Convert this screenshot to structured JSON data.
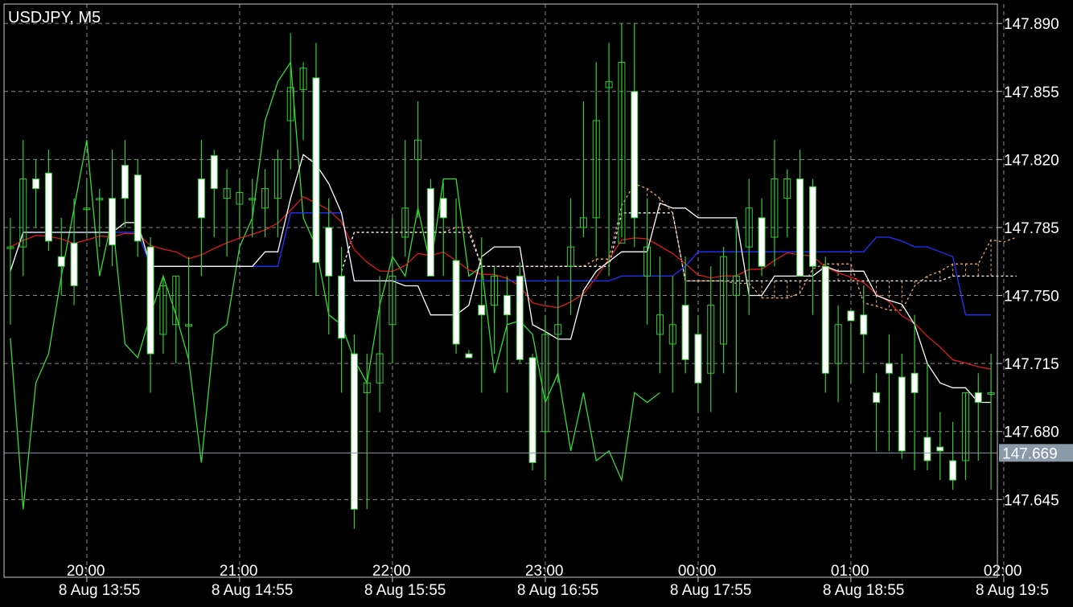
{
  "header": {
    "symbol_timeframe": "USDJPY, M5"
  },
  "colors": {
    "background": "#000000",
    "frame": "#c8c8c8",
    "grid": "#8a8a8a",
    "candle_body": "#ffffff",
    "candle_wick": "#33cc33",
    "red_line": "#e01b1b",
    "blue_line": "#2233ff",
    "white_line": "#ffffff",
    "green_line": "#33dd33",
    "cloud": "#f0a56a",
    "current_price_line": "#8a9aa8",
    "price_tag_bg": "#8a9aa8"
  },
  "chart_data": {
    "type": "candlestick",
    "symbol": "USDJPY",
    "timeframe": "M5",
    "ylim": [
      147.605,
      147.9
    ],
    "y_ticks": [
      "147.890",
      "147.855",
      "147.820",
      "147.785",
      "147.750",
      "147.715",
      "147.680",
      "147.645"
    ],
    "current_price": {
      "label": "147.669",
      "value": 147.669
    },
    "time_labels_upper": [
      {
        "label": "20:00",
        "index": 6
      },
      {
        "label": "21:00",
        "index": 18
      },
      {
        "label": "22:00",
        "index": 30
      },
      {
        "label": "23:00",
        "index": 42
      },
      {
        "label": "00:00",
        "index": 54
      },
      {
        "label": "01:00",
        "index": 66
      },
      {
        "label": "02:00",
        "index": 78
      }
    ],
    "time_labels_lower": [
      {
        "label": "8 Aug 13:55",
        "index": 6
      },
      {
        "label": "8 Aug 14:55",
        "index": 18
      },
      {
        "label": "8 Aug 15:55",
        "index": 30
      },
      {
        "label": "8 Aug 16:55",
        "index": 42
      },
      {
        "label": "8 Aug 17:55",
        "index": 54
      },
      {
        "label": "8 Aug 18:55",
        "index": 66
      },
      {
        "label": "8 Aug 19:5",
        "index": 78
      }
    ],
    "candles": [
      [
        147.775,
        147.79,
        147.735,
        147.775
      ],
      [
        147.775,
        147.83,
        147.76,
        147.81
      ],
      [
        147.81,
        147.82,
        147.785,
        147.805
      ],
      [
        147.813,
        147.825,
        147.773,
        147.778
      ],
      [
        147.77,
        147.79,
        147.75,
        147.765
      ],
      [
        147.777,
        147.8,
        147.745,
        147.755
      ],
      [
        147.795,
        147.81,
        147.78,
        147.795
      ],
      [
        147.8,
        147.805,
        147.775,
        147.8
      ],
      [
        147.8,
        147.825,
        147.765,
        147.776
      ],
      [
        147.817,
        147.83,
        147.785,
        147.8
      ],
      [
        147.812,
        147.82,
        147.77,
        147.778
      ],
      [
        147.775,
        147.78,
        147.7,
        147.72
      ],
      [
        147.73,
        147.76,
        147.72,
        147.755
      ],
      [
        147.735,
        147.76,
        147.715,
        147.76
      ],
      [
        147.735,
        147.77,
        147.715,
        147.735
      ],
      [
        147.81,
        147.83,
        147.76,
        147.79
      ],
      [
        147.822,
        147.825,
        147.78,
        147.805
      ],
      [
        147.8,
        147.815,
        147.77,
        147.805
      ],
      [
        147.797,
        147.81,
        147.78,
        147.803
      ],
      [
        147.8,
        147.81,
        147.78,
        147.8
      ],
      [
        147.795,
        147.815,
        147.78,
        147.805
      ],
      [
        147.8,
        147.825,
        147.78,
        147.82
      ],
      [
        147.84,
        147.885,
        147.815,
        147.857
      ],
      [
        147.856,
        147.87,
        147.83,
        147.867
      ],
      [
        147.862,
        147.88,
        147.75,
        147.767
      ],
      [
        147.785,
        147.8,
        147.73,
        147.76
      ],
      [
        147.76,
        147.775,
        147.7,
        147.728
      ],
      [
        147.72,
        147.73,
        147.63,
        147.64
      ],
      [
        147.7,
        147.72,
        147.64,
        147.705
      ],
      [
        147.705,
        147.76,
        147.69,
        147.72
      ],
      [
        147.735,
        147.79,
        147.715,
        147.76
      ],
      [
        147.78,
        147.83,
        147.77,
        147.795
      ],
      [
        147.82,
        147.85,
        147.79,
        147.83
      ],
      [
        147.805,
        147.81,
        147.76,
        147.76
      ],
      [
        147.8,
        147.808,
        147.76,
        147.79
      ],
      [
        147.768,
        147.8,
        147.72,
        147.725
      ],
      [
        147.72,
        147.722,
        147.718,
        147.718
      ],
      [
        147.745,
        147.78,
        147.7,
        147.74
      ],
      [
        147.745,
        147.765,
        147.72,
        147.76
      ],
      [
        147.75,
        147.76,
        147.7,
        147.74
      ],
      [
        147.76,
        147.767,
        147.715,
        147.717
      ],
      [
        147.718,
        147.72,
        147.66,
        147.664
      ],
      [
        147.68,
        147.74,
        147.655,
        147.73
      ],
      [
        147.73,
        147.76,
        147.705,
        147.735
      ],
      [
        147.765,
        147.8,
        147.74,
        147.775
      ],
      [
        147.785,
        147.85,
        147.78,
        147.79
      ],
      [
        147.79,
        147.87,
        147.77,
        147.84
      ],
      [
        147.857,
        147.88,
        147.76,
        147.86
      ],
      [
        147.777,
        147.89,
        147.78,
        147.87
      ],
      [
        147.855,
        147.89,
        147.775,
        147.79
      ],
      [
        147.76,
        147.8,
        147.735,
        147.775
      ],
      [
        147.73,
        147.77,
        147.71,
        147.74
      ],
      [
        147.725,
        147.76,
        147.7,
        147.735
      ],
      [
        147.745,
        147.77,
        147.71,
        147.717
      ],
      [
        147.73,
        147.74,
        147.69,
        147.705
      ],
      [
        147.71,
        147.765,
        147.69,
        147.745
      ],
      [
        147.725,
        147.775,
        147.71,
        147.77
      ],
      [
        147.75,
        147.79,
        147.7,
        147.76
      ],
      [
        147.775,
        147.81,
        147.74,
        147.795
      ],
      [
        147.79,
        147.8,
        147.76,
        147.765
      ],
      [
        147.78,
        147.83,
        147.765,
        147.81
      ],
      [
        147.8,
        147.815,
        147.78,
        147.81
      ],
      [
        147.81,
        147.825,
        147.76,
        147.76
      ],
      [
        147.806,
        147.81,
        147.74,
        147.765
      ],
      [
        147.765,
        147.77,
        147.7,
        147.71
      ],
      [
        147.715,
        147.745,
        147.695,
        147.735
      ],
      [
        147.742,
        147.735,
        147.705,
        147.737
      ],
      [
        147.74,
        147.755,
        147.71,
        147.73
      ],
      [
        147.7,
        147.71,
        147.67,
        147.695
      ],
      [
        147.715,
        147.73,
        147.67,
        147.71
      ],
      [
        147.708,
        147.72,
        147.666,
        147.67
      ],
      [
        147.71,
        147.74,
        147.66,
        147.7
      ],
      [
        147.677,
        147.715,
        147.66,
        147.665
      ],
      [
        147.672,
        147.69,
        147.655,
        147.67
      ],
      [
        147.665,
        147.685,
        147.65,
        147.655
      ],
      [
        147.665,
        147.7,
        147.655,
        147.7
      ],
      [
        147.7,
        147.71,
        147.665,
        147.695
      ],
      [
        147.7,
        147.72,
        147.65,
        147.7
      ]
    ]
  }
}
